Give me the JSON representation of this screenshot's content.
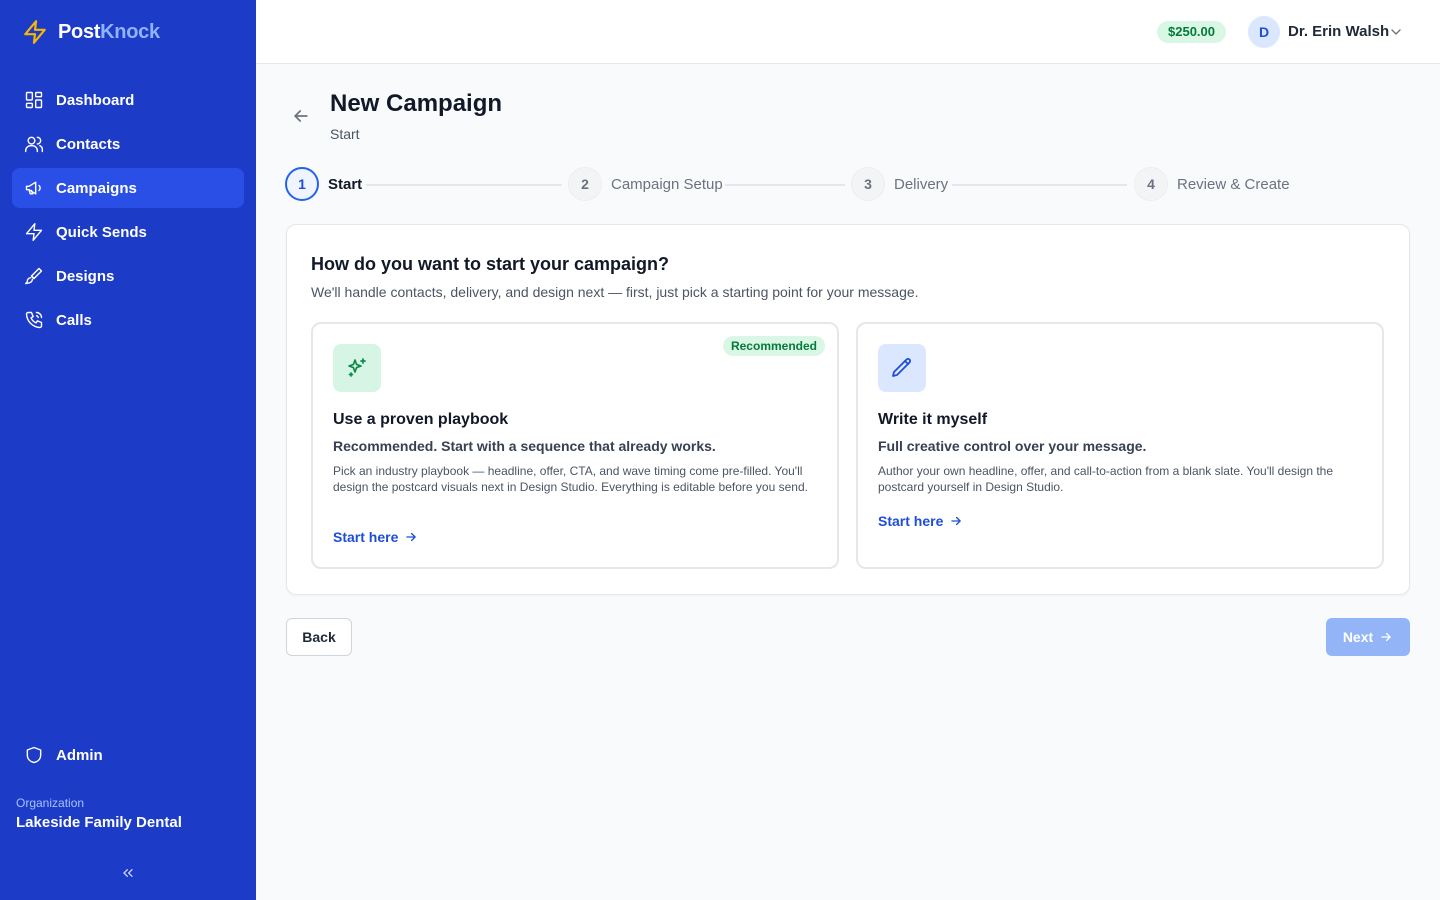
{
  "app": {
    "brand_part1": "Post",
    "brand_part2": "Knock"
  },
  "sidebar": {
    "items": [
      {
        "label": "Dashboard",
        "icon": "grid-icon"
      },
      {
        "label": "Contacts",
        "icon": "users-icon"
      },
      {
        "label": "Campaigns",
        "icon": "megaphone-icon",
        "active": true
      },
      {
        "label": "Quick Sends",
        "icon": "lightning-icon"
      },
      {
        "label": "Designs",
        "icon": "paintbrush-icon"
      },
      {
        "label": "Calls",
        "icon": "phone-icon"
      }
    ],
    "admin_label": "Admin",
    "org_label": "Organization",
    "org_name": "Lakeside Family Dental"
  },
  "topbar": {
    "balance": "$250.00",
    "avatar_initial": "D",
    "user_name": "Dr. Erin Walsh"
  },
  "header": {
    "title": "New Campaign",
    "subtitle": "Start"
  },
  "stepper": {
    "steps": [
      {
        "num": "1",
        "label": "Start",
        "state": "active"
      },
      {
        "num": "2",
        "label": "Campaign Setup",
        "state": "inactive"
      },
      {
        "num": "3",
        "label": "Delivery",
        "state": "inactive"
      },
      {
        "num": "4",
        "label": "Review & Create",
        "state": "inactive"
      }
    ]
  },
  "main": {
    "question": "How do you want to start your campaign?",
    "description": "We'll handle contacts, delivery, and design next — first, just pick a starting point for your message.",
    "options": [
      {
        "icon": "sparkles-icon",
        "badge": "Recommended",
        "title": "Use a proven playbook",
        "subtitle": "Recommended. Start with a sequence that already works.",
        "body": "Pick an industry playbook — headline, offer, CTA, and wave timing come pre-filled. You'll design the postcard visuals next in Design Studio. Everything is editable before you send.",
        "link": "Start here"
      },
      {
        "icon": "pencil-icon",
        "title": "Write it myself",
        "subtitle": "Full creative control over your message.",
        "body": "Author your own headline, offer, and call-to-action from a blank slate. You'll design the postcard yourself in Design Studio.",
        "link": "Start here"
      }
    ]
  },
  "footer": {
    "back_label": "Back",
    "next_label": "Next"
  },
  "colors": {
    "sidebar_bg": "#1c3bc7",
    "sidebar_active": "#2a4fe6",
    "accent": "#2563eb",
    "success_bg": "#d9f7e4",
    "success_text": "#047a3c",
    "next_disabled": "#93b4f7"
  }
}
